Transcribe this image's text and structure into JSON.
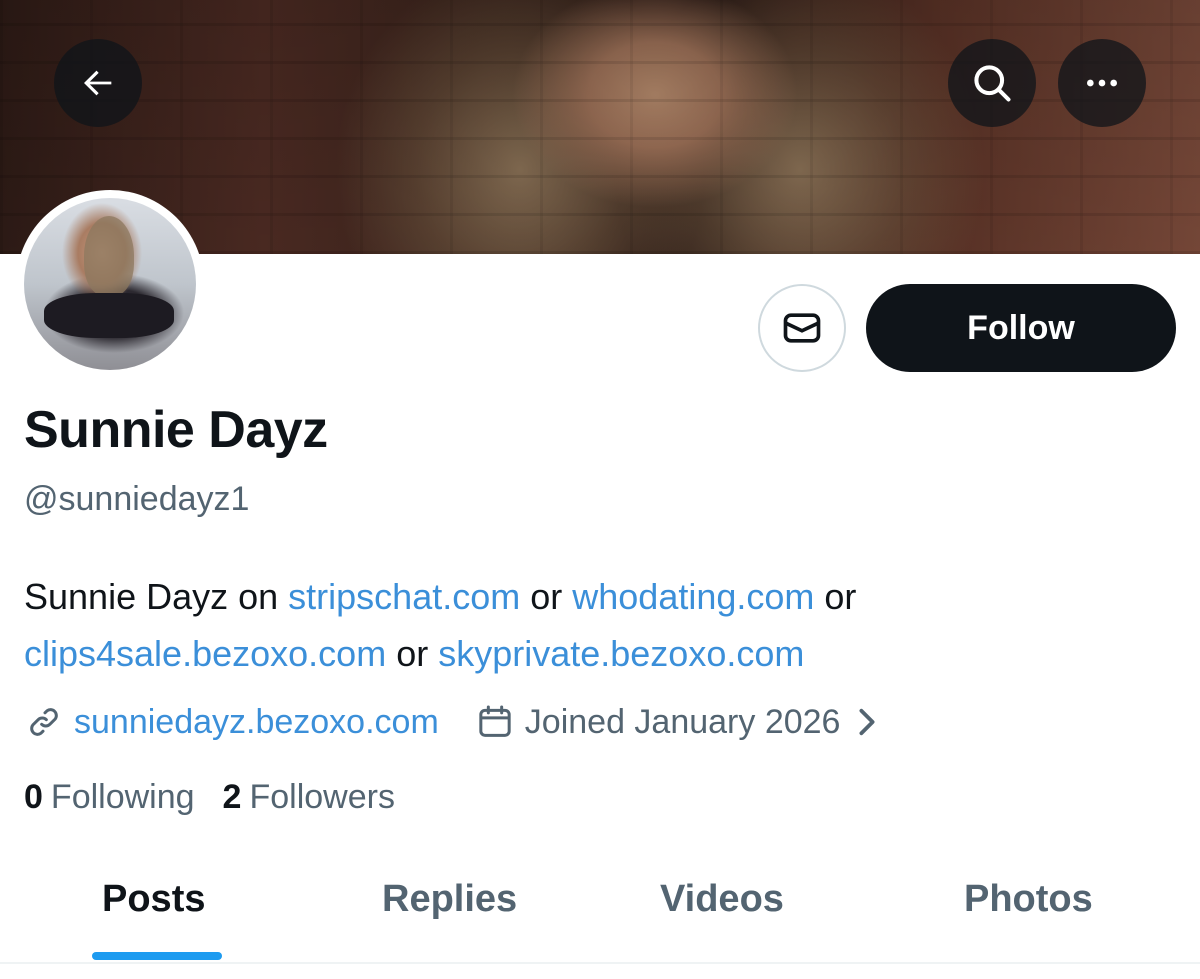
{
  "header": {
    "back_icon": "arrow-left-icon",
    "search_icon": "search-icon",
    "more_icon": "more-horizontal-icon"
  },
  "profile": {
    "display_name": "Sunnie Dayz",
    "handle": "@sunniedayz1",
    "follow_label": "Follow",
    "message_icon": "envelope-icon",
    "bio": {
      "prefix": "Sunnie Dayz on ",
      "link1": "stripschat.com",
      "sep1": " or ",
      "link2": "whodating.com",
      "sep2": " or ",
      "link3": "clips4sale.bezoxo.com",
      "sep3": " or ",
      "link4": "skyprivate.bezoxo.com"
    },
    "website": "sunniedayz.bezoxo.com",
    "joined": "Joined January 2026",
    "following_count": "0",
    "following_label": "Following",
    "followers_count": "2",
    "followers_label": "Followers"
  },
  "tabs": [
    {
      "label": "Posts",
      "active": true
    },
    {
      "label": "Replies",
      "active": false
    },
    {
      "label": "Videos",
      "active": false
    },
    {
      "label": "Photos",
      "active": false
    }
  ],
  "colors": {
    "link": "#3b8fd9",
    "accent": "#1d9bf0",
    "primary_text": "#0f1419",
    "secondary_text": "#536471"
  }
}
